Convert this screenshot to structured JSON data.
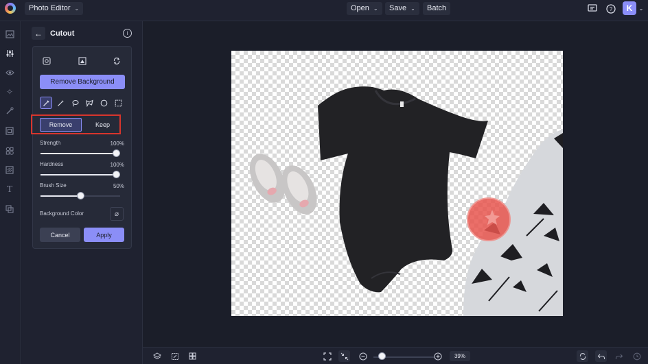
{
  "topbar": {
    "app_menu_label": "Photo Editor",
    "open_label": "Open",
    "save_label": "Save",
    "batch_label": "Batch",
    "avatar_initial": "K"
  },
  "left_rail": {
    "items": [
      "image-icon",
      "sliders-icon",
      "eye-icon",
      "sparkle-icon",
      "brush-icon",
      "frame-icon",
      "shapes-icon",
      "texture-icon",
      "text-icon",
      "overlay-icon"
    ],
    "active": "sliders-icon"
  },
  "panel": {
    "title": "Cutout",
    "remove_background_label": "Remove Background",
    "mode": {
      "remove_label": "Remove",
      "keep_label": "Keep",
      "selected": "Remove"
    },
    "sliders": [
      {
        "label": "Strength",
        "value_text": "100%",
        "value": 100
      },
      {
        "label": "Hardness",
        "value_text": "100%",
        "value": 100
      },
      {
        "label": "Brush Size",
        "value_text": "50%",
        "value": 50
      }
    ],
    "background_color_label": "Background Color",
    "cancel_label": "Cancel",
    "apply_label": "Apply"
  },
  "bottombar": {
    "zoom_text": "39%",
    "zoom_value": 39
  },
  "colors": {
    "accent": "#8b8ef7",
    "highlight_frame": "#d8352c",
    "bg": "#1b1e29",
    "panel": "#1f2230"
  }
}
